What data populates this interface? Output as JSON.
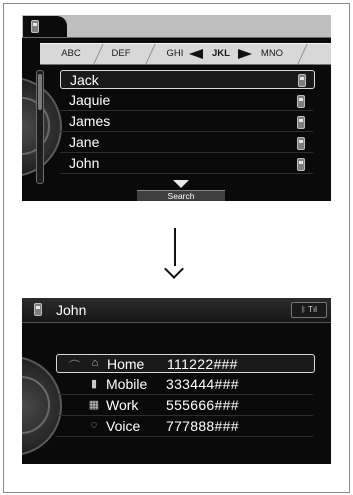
{
  "screen1": {
    "tabs": [
      "ABC",
      "DEF",
      "GHI",
      "JKL",
      "MNO"
    ],
    "active_tab": "JKL",
    "contacts": [
      {
        "name": "Jack",
        "icon": "mobile-phone-icon"
      },
      {
        "name": "Jaquie",
        "icon": "mobile-phone-icon"
      },
      {
        "name": "James",
        "icon": "mobile-phone-icon"
      },
      {
        "name": "Jane",
        "icon": "mobile-phone-icon"
      },
      {
        "name": "John",
        "icon": "mobile-phone-icon"
      }
    ],
    "search_label": "Search"
  },
  "screen2": {
    "title": "John",
    "status_glyphs": "ᛒ Tıl",
    "entries": [
      {
        "icon_glyph": "⌂",
        "label": "Home",
        "number": "111222###"
      },
      {
        "icon_glyph": "▮",
        "label": "Mobile",
        "number": "333444###"
      },
      {
        "icon_glyph": "▦",
        "label": "Work",
        "number": "555666###"
      },
      {
        "icon_glyph": "◌",
        "label": "Voice",
        "number": "777888###"
      }
    ]
  },
  "colors": {
    "screen_bg": "#0a0a0a",
    "tab_bg": "#d8d8d8",
    "selection_border": "#d9d9d9"
  }
}
